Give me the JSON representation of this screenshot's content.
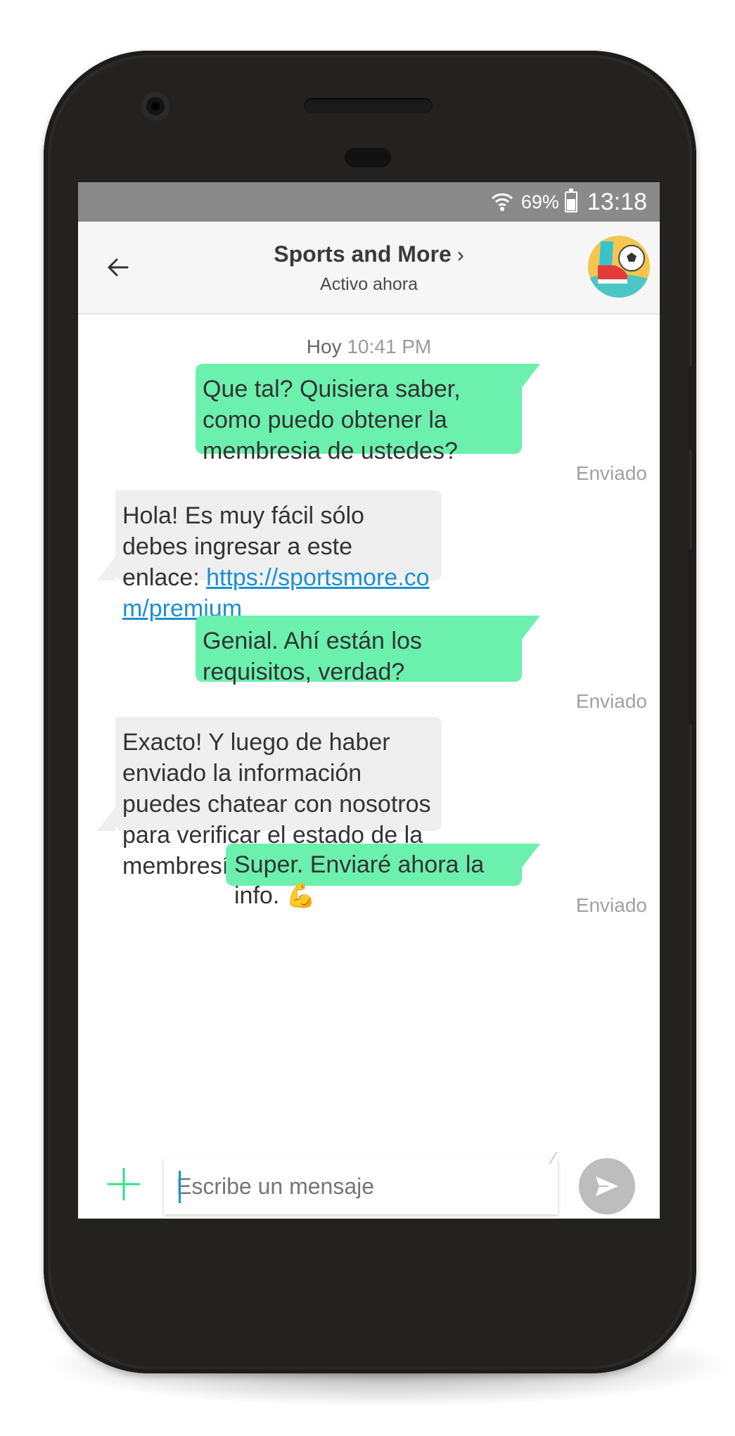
{
  "statusbar": {
    "battery": "69%",
    "time": "13:18",
    "icons": [
      "wifi-icon",
      "battery-icon"
    ]
  },
  "header": {
    "back_icon": "arrow-left-icon",
    "title": "Sports and More",
    "chevron": "›",
    "subtitle": "Activo ahora",
    "avatar": "sports-avatar"
  },
  "chat": {
    "date_label": "Hoy",
    "date_time": "10:41 PM",
    "messages": [
      {
        "side": "out",
        "text": "Que tal? Quisiera saber, como puedo obtener la membresia de ustedes?",
        "status": "Enviado"
      },
      {
        "side": "in",
        "text_before": "Hola! Es muy fácil sólo debes ingresar a este enlace: ",
        "link": "https://sportsmore.com/premium"
      },
      {
        "side": "out",
        "text": "Genial. Ahí están los requisitos, verdad?",
        "status": "Enviado"
      },
      {
        "side": "in",
        "text": "Exacto! Y luego de haber enviado la información puedes chatear con nosotros para verificar el estado de la membresía."
      },
      {
        "side": "out",
        "text": "Super. Enviaré ahora la info. 💪",
        "status": "Enviado"
      }
    ]
  },
  "composer": {
    "placeholder": "Escribe un mensaje",
    "add_icon": "plus-icon",
    "send_icon": "send-icon"
  },
  "colors": {
    "outgoing_bubble": "#6cf0ae",
    "incoming_bubble": "#efefef",
    "link": "#1c8fd0",
    "accent_green": "#2ee37f",
    "statusbar": "#8a8a8a"
  }
}
